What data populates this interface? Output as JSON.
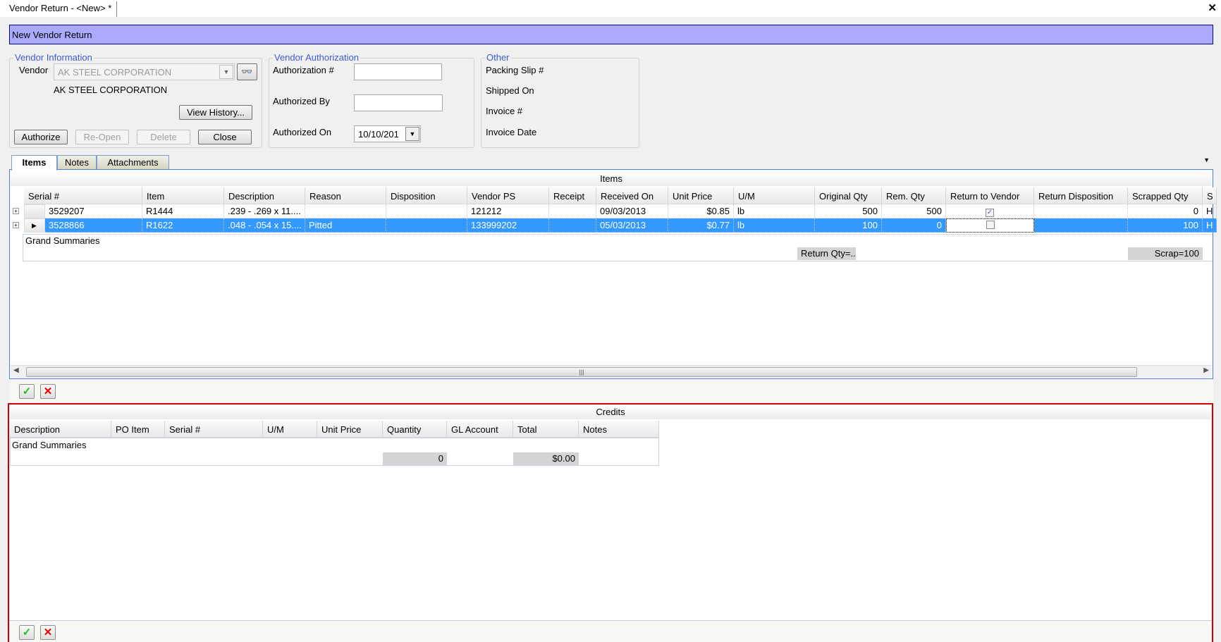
{
  "window": {
    "tab_title": "Vendor Return - <New> *",
    "close_icon": "close-icon"
  },
  "banner": {
    "title": "New Vendor Return",
    "color": "#aaaaff"
  },
  "vendor_info": {
    "legend": "Vendor Information",
    "vendor_label": "Vendor",
    "vendor_value": "AK STEEL CORPORATION",
    "vendor_name": "AK STEEL CORPORATION",
    "view_history": "View History...",
    "authorize": "Authorize",
    "reopen": "Re-Open",
    "delete": "Delete",
    "close": "Close"
  },
  "vendor_auth": {
    "legend": "Vendor Authorization",
    "auth_no_label": "Authorization #",
    "auth_no_value": "",
    "auth_by_label": "Authorized By",
    "auth_by_value": "",
    "auth_on_label": "Authorized On",
    "auth_on_value": "10/10/201"
  },
  "other": {
    "legend": "Other",
    "packing_slip": "Packing Slip #",
    "shipped_on": "Shipped On",
    "invoice_no": "Invoice #",
    "invoice_date": "Invoice Date"
  },
  "tabs": [
    {
      "label": "Items",
      "active": true
    },
    {
      "label": "Notes"
    },
    {
      "label": "Attachments"
    }
  ],
  "items": {
    "title": "Items",
    "columns": [
      "Serial #",
      "Item",
      "Description",
      "Reason",
      "Disposition",
      "Vendor PS",
      "Receipt",
      "Received On",
      "Unit Price",
      "U/M",
      "Original Qty",
      "Rem. Qty",
      "Return to Vendor",
      "Return Disposition",
      "Scrapped Qty",
      "S"
    ],
    "rows": [
      {
        "selected": false,
        "cells": [
          "3529207",
          "R1444",
          ".239 - .269 x 11....",
          "",
          "",
          "121212",
          "",
          "09/03/2013",
          "$0.85",
          "lb",
          "500",
          "500",
          true,
          "",
          "0",
          "H"
        ]
      },
      {
        "selected": true,
        "cells": [
          "3528866",
          "R1622",
          ".048 - .054  x 15....",
          "Pitted",
          "",
          "133999202",
          "",
          "05/03/2013",
          "$0.77",
          "lb",
          "100",
          "0",
          false,
          "",
          "100",
          "H"
        ]
      }
    ],
    "grand_summaries": "Grand Summaries",
    "summary_return_qty": "Return Qty=...",
    "summary_scrap": "Scrap=100"
  },
  "credits": {
    "title": "Credits",
    "columns": [
      "Description",
      "PO Item",
      "Serial #",
      "U/M",
      "Unit Price",
      "Quantity",
      "GL Account",
      "Total",
      "Notes"
    ],
    "grand_summaries": "Grand Summaries",
    "summary_quantity": "0",
    "summary_total": "$0.00"
  },
  "colors": {
    "selection": "#3399ff",
    "credits_border": "#cc0000",
    "accept": "#22bb22",
    "cancel": "#ee0000"
  }
}
